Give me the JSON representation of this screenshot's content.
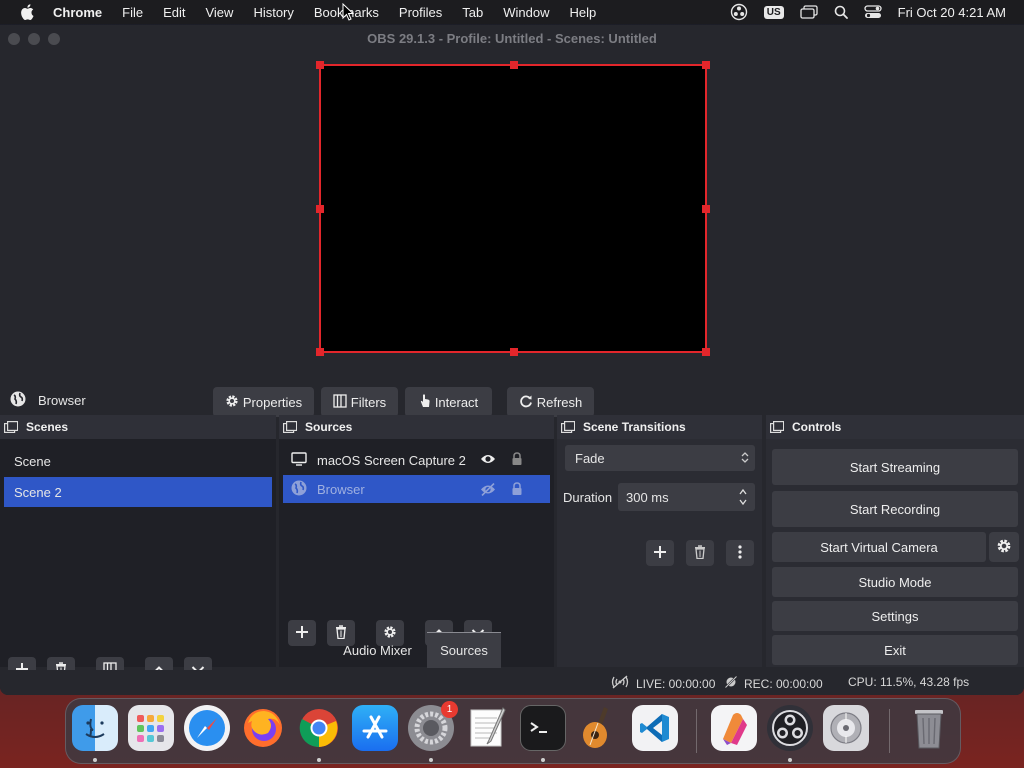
{
  "menubar": {
    "app": "Chrome",
    "items": [
      "File",
      "Edit",
      "View",
      "History",
      "Bookmarks",
      "Profiles",
      "Tab",
      "Window",
      "Help"
    ],
    "input_source": "US",
    "clock": "Fri Oct 20  4:21 AM"
  },
  "window": {
    "title": "OBS 29.1.3 - Profile: Untitled - Scenes: Untitled"
  },
  "context_bar": {
    "source_name": "Browser",
    "properties": "Properties",
    "filters": "Filters",
    "interact": "Interact",
    "refresh": "Refresh"
  },
  "scenes": {
    "title": "Scenes",
    "items": [
      {
        "name": "Scene",
        "selected": false
      },
      {
        "name": "Scene 2",
        "selected": true
      }
    ]
  },
  "sources": {
    "title": "Sources",
    "items": [
      {
        "name": "macOS Screen Capture 2",
        "icon": "monitor-icon",
        "visible": true,
        "selected": false
      },
      {
        "name": "Browser",
        "icon": "globe-icon",
        "visible": false,
        "selected": true
      }
    ]
  },
  "transitions": {
    "title": "Scene Transitions",
    "selected": "Fade",
    "duration_label": "Duration",
    "duration_value": "300 ms"
  },
  "controls": {
    "title": "Controls",
    "start_streaming": "Start Streaming",
    "start_recording": "Start Recording",
    "start_virtual_camera": "Start Virtual Camera",
    "studio_mode": "Studio Mode",
    "settings": "Settings",
    "exit": "Exit"
  },
  "tabs": {
    "audio_mixer": "Audio Mixer",
    "sources": "Sources"
  },
  "status": {
    "live": "LIVE: 00:00:00",
    "rec": "REC: 00:00:00",
    "cpu": "CPU: 11.5%, 43.28 fps"
  },
  "dock": {
    "apps": [
      "finder-icon",
      "launchpad-icon",
      "safari-icon",
      "firefox-icon",
      "chrome-icon",
      "app-store-icon",
      "system-settings-icon",
      "textedit-icon",
      "terminal-icon",
      "garageband-icon",
      "vscode-icon",
      "pixelmator-icon",
      "obs-icon",
      "disk-utility-icon",
      "trash-icon"
    ],
    "settings_badge": "1"
  },
  "colors": {
    "selection": "#2f57c7",
    "canvas_outline": "#e3262b",
    "window_bg": "#26272d"
  }
}
